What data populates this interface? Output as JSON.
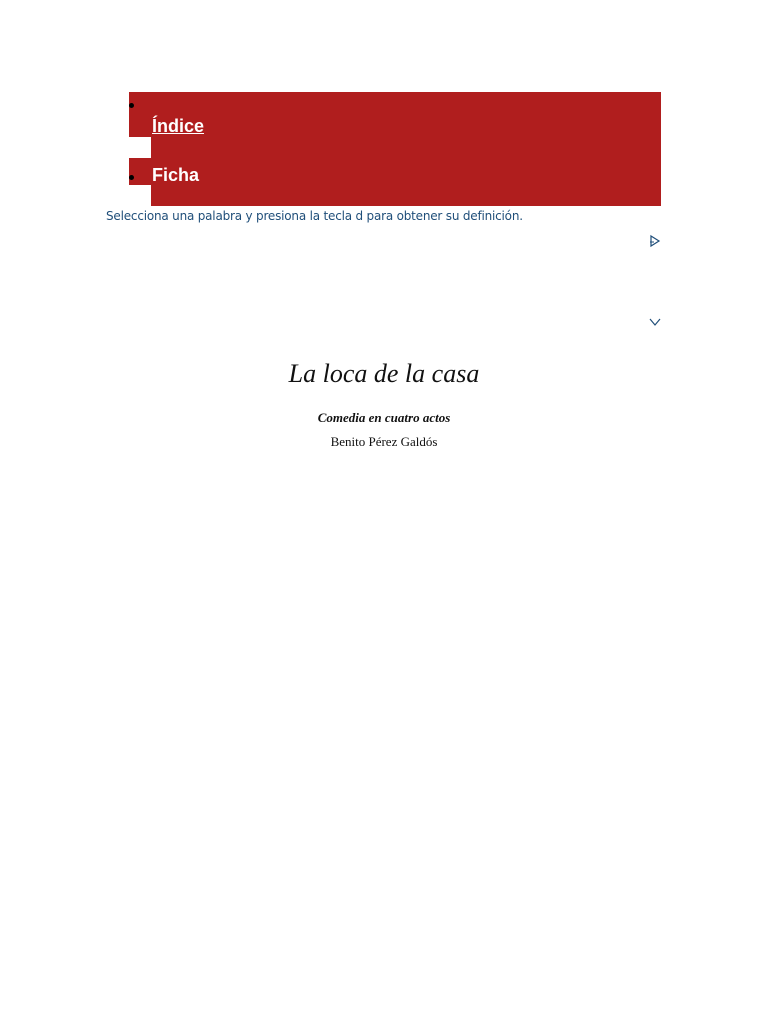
{
  "nav": {
    "items": [
      {
        "label": "Índice"
      },
      {
        "label": "Ficha"
      }
    ],
    "background_color": "#b01e1e"
  },
  "hint": {
    "text": "Selecciona una palabra y presiona la tecla d para obtener su definición."
  },
  "controls": {
    "play_icon": "play-triangle-icon",
    "down_icon": "chevron-down-icon",
    "icon_color": "#1f4e79"
  },
  "book": {
    "title": "La loca de la casa",
    "subtitle": "Comedia en cuatro actos",
    "author": "Benito Pérez Galdós"
  }
}
